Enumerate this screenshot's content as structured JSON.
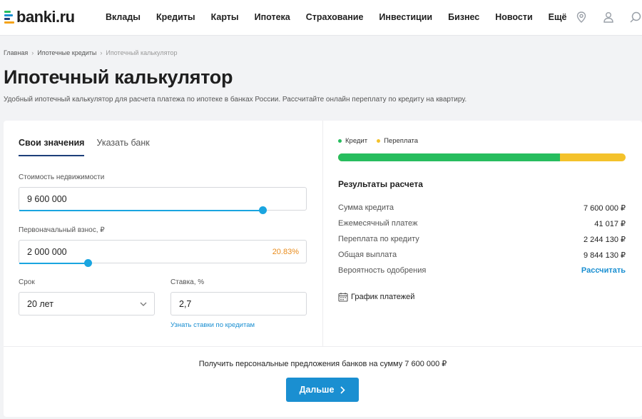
{
  "header": {
    "logo_text": "banki.ru",
    "nav": [
      "Вклады",
      "Кредиты",
      "Карты",
      "Ипотека",
      "Страхование",
      "Инвестиции",
      "Бизнес",
      "Новости",
      "Ещё"
    ],
    "icons": [
      "location-pin-icon",
      "user-icon",
      "search-icon"
    ]
  },
  "breadcrumb": {
    "home": "Главная",
    "section": "Ипотечные кредиты",
    "current": "Ипотечный калькулятор"
  },
  "page": {
    "title": "Ипотечный калькулятор",
    "subtitle": "Удобный ипотечный калькулятор для расчета платежа по ипотеке в банках России. Рассчитайте онлайн переплату по кредиту на квартиру."
  },
  "form": {
    "tabs": [
      "Свои значения",
      "Указать банк"
    ],
    "property_label": "Стоимость недвижимости",
    "property_value": "9 600 000",
    "property_slider": 0.85,
    "downpayment_label": "Первоначальный взнос, ₽",
    "downpayment_value": "2 000 000",
    "downpayment_percent": "20.83%",
    "downpayment_slider": 0.24,
    "term_label": "Срок",
    "term_value": "20 лет",
    "rate_label": "Ставка, %",
    "rate_value": "2,7",
    "rates_link": "Узнать ставки по кредитам"
  },
  "results": {
    "legend_credit": "Кредит",
    "legend_overpay": "Переплата",
    "credit_share": 0.772,
    "title": "Результаты расчета",
    "rows": [
      {
        "label": "Сумма кредита",
        "value": "7 600 000 ₽"
      },
      {
        "label": "Ежемесячный платеж",
        "value": "41 017 ₽"
      },
      {
        "label": "Переплата по кредиту",
        "value": "2 244 130 ₽"
      },
      {
        "label": "Общая выплата",
        "value": "9 844 130 ₽"
      },
      {
        "label": "Вероятность одобрения",
        "value": "Рассчитать"
      }
    ],
    "schedule_label": "График платежей"
  },
  "offer": {
    "text": "Получить персональные предложения банков на сумму 7 600 000 ₽",
    "button_label": "Дальше"
  },
  "colors": {
    "accent": "#1a8fd1",
    "credit": "#27bd5e",
    "overpay": "#f4c22b",
    "percent": "#e98b1a"
  }
}
